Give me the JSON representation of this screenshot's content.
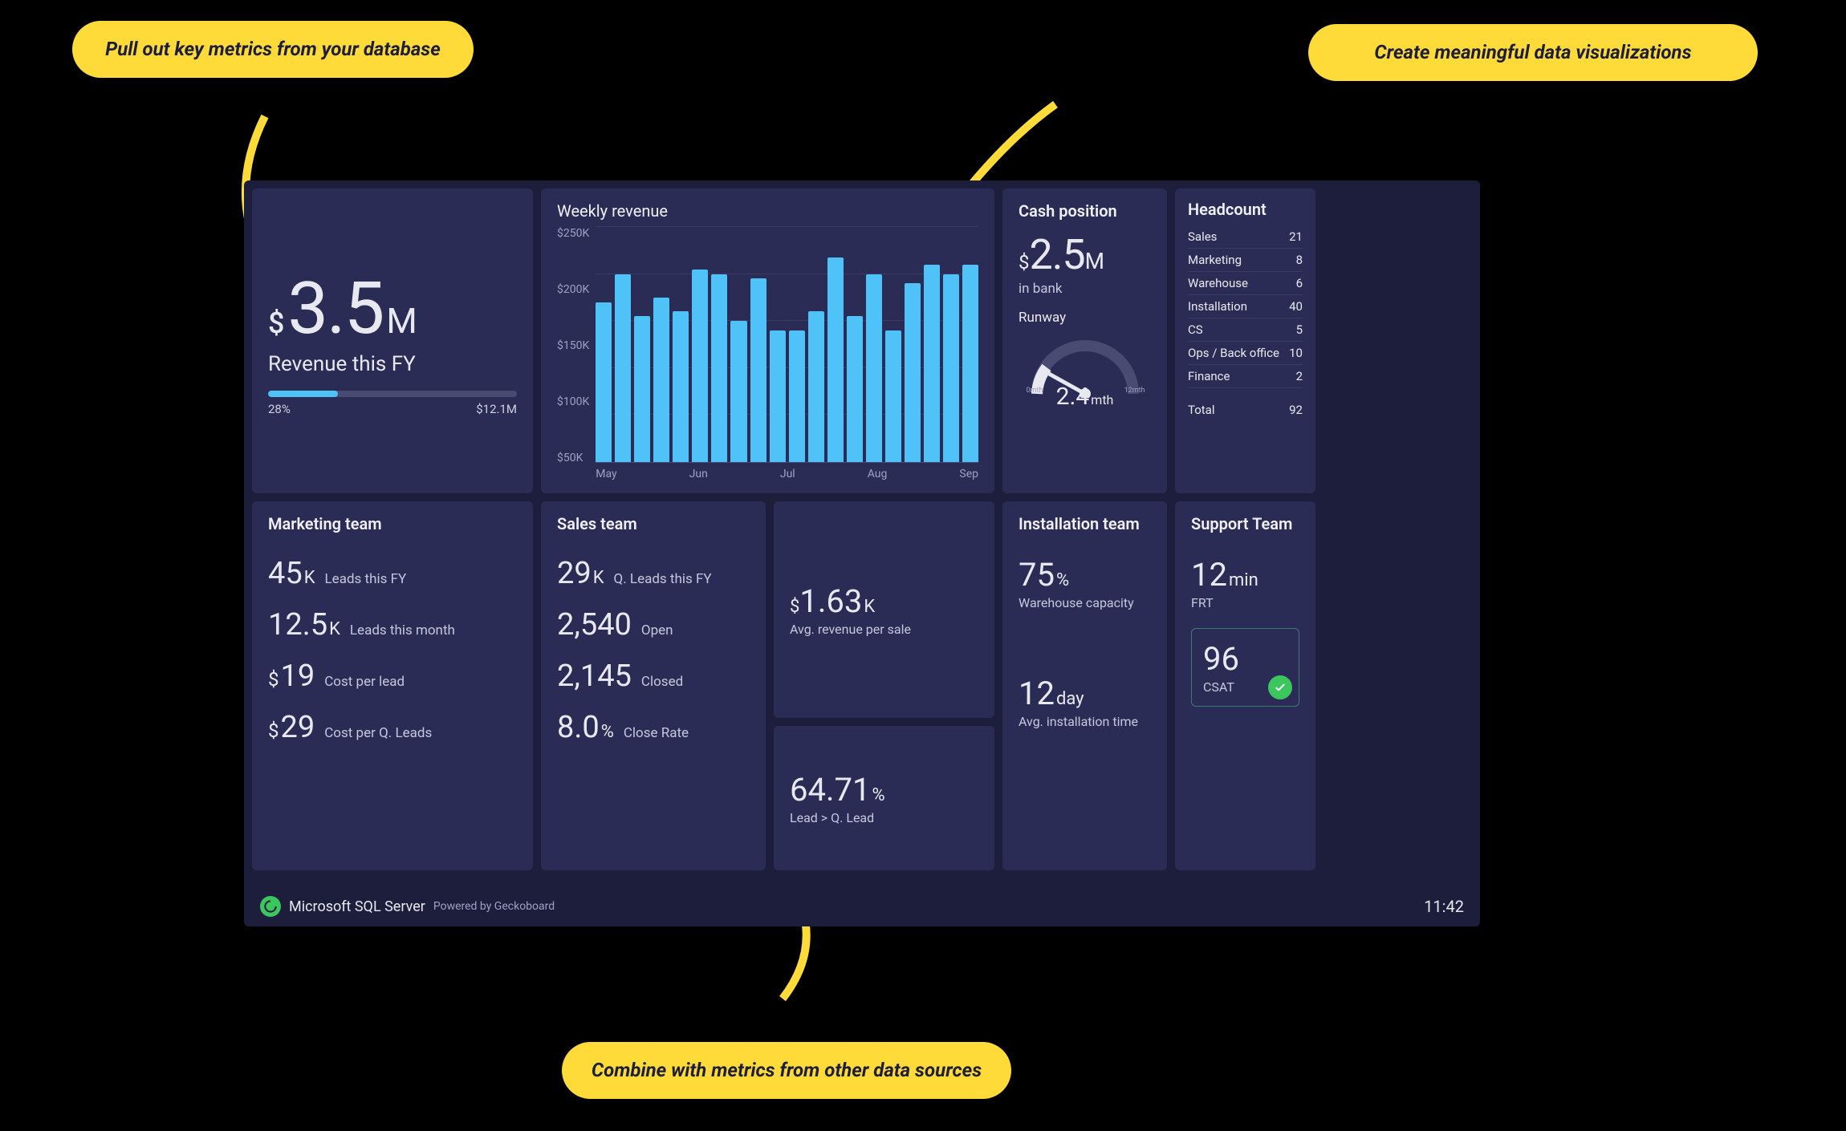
{
  "annotations": {
    "a1": "Pull out key metrics from your database",
    "a2": "Create meaningful data visualizations",
    "a3": "Combine with metrics from other data sources"
  },
  "revenue": {
    "prefix": "$",
    "value": "3.5",
    "suffix": "M",
    "label": "Revenue this FY",
    "progress_pct": "28%",
    "target": "$12.1M"
  },
  "chart_title": "Weekly revenue",
  "chart_data": {
    "type": "bar",
    "title": "Weekly revenue",
    "xlabel": "",
    "ylabel": "",
    "ylim": [
      0,
      250000
    ],
    "yticks": [
      "$250K",
      "$200K",
      "$150K",
      "$100K",
      "$50K"
    ],
    "xticks": [
      "May",
      "Jun",
      "Jul",
      "Aug",
      "Sep"
    ],
    "values": [
      170000,
      200000,
      155000,
      175000,
      160000,
      205000,
      200000,
      150000,
      195000,
      140000,
      140000,
      160000,
      218000,
      155000,
      200000,
      140000,
      190000,
      210000,
      200000,
      210000
    ],
    "bar_color": "#4fc3f7"
  },
  "cash": {
    "title": "Cash position",
    "prefix": "$",
    "value": "2.5",
    "suffix": "M",
    "sub": "in bank",
    "runway_title": "Runway",
    "runway_value": "2.4",
    "runway_suffix": "mth",
    "gauge_min": "0mth",
    "gauge_max": "12mth"
  },
  "headcount": {
    "title": "Headcount",
    "rows": [
      {
        "label": "Sales",
        "value": "21"
      },
      {
        "label": "Marketing",
        "value": "8"
      },
      {
        "label": "Warehouse",
        "value": "6"
      },
      {
        "label": "Installation",
        "value": "40"
      },
      {
        "label": "CS",
        "value": "5"
      },
      {
        "label": "Ops / Back office",
        "value": "10"
      },
      {
        "label": "Finance",
        "value": "2"
      }
    ],
    "total_label": "Total",
    "total_value": "92"
  },
  "marketing": {
    "title": "Marketing team",
    "m1_value": "45",
    "m1_suffix": "K",
    "m1_label": "Leads this FY",
    "m2_value": "12.5",
    "m2_suffix": "K",
    "m2_label": "Leads this month",
    "m3_prefix": "$",
    "m3_value": "19",
    "m3_label": "Cost per lead",
    "m4_prefix": "$",
    "m4_value": "29",
    "m4_label": "Cost per Q. Leads"
  },
  "sales": {
    "title": "Sales team",
    "s1_value": "29",
    "s1_suffix": "K",
    "s1_label": "Q. Leads this FY",
    "s2_value": "2,540",
    "s2_label": "Open",
    "s3_value": "2,145",
    "s3_label": "Closed",
    "s4_value": "8.0",
    "s4_suffix": "%",
    "s4_label": "Close Rate"
  },
  "avg_rev": {
    "prefix": "$",
    "value": "1.63",
    "suffix": "K",
    "label": "Avg. revenue per sale"
  },
  "lead_conv": {
    "value": "64.71",
    "suffix": "%",
    "label": "Lead > Q. Lead"
  },
  "install": {
    "title": "Installation team",
    "i1_value": "75",
    "i1_suffix": "%",
    "i1_label": "Warehouse capacity",
    "i2_value": "12",
    "i2_suffix": "day",
    "i2_label": "Avg. installation time"
  },
  "support": {
    "title": "Support Team",
    "t1_value": "12",
    "t1_suffix": "min",
    "t1_label": "FRT",
    "t2_value": "96",
    "t2_label": "CSAT"
  },
  "footer": {
    "source": "Microsoft SQL Server",
    "powered": "Powered by Geckoboard",
    "clock": "11:42"
  }
}
